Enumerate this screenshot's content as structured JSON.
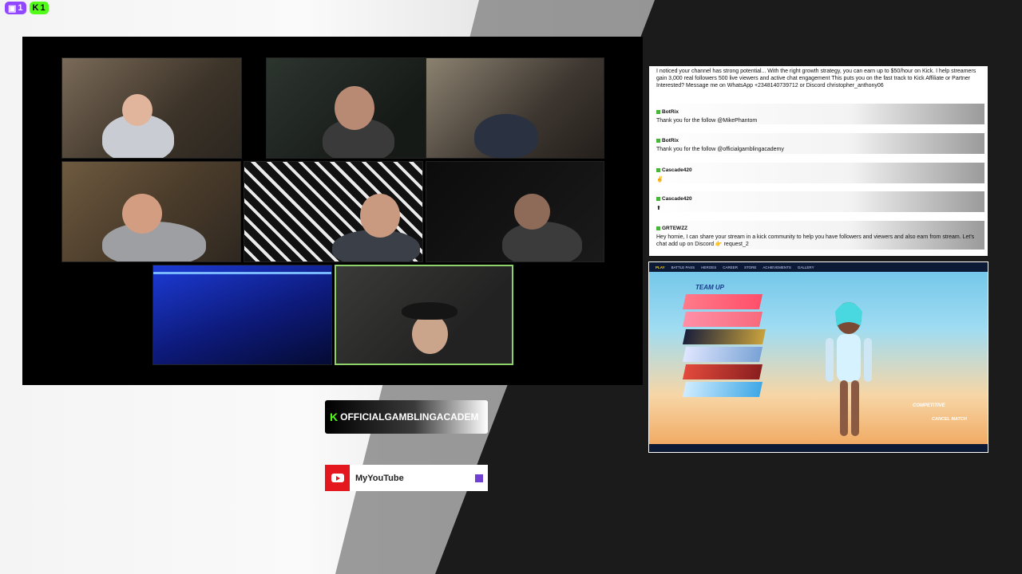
{
  "platform_badges": {
    "twitch_count": "1",
    "kick_count": "1"
  },
  "camera_grid": {
    "tiles": [
      {
        "name": "cam-1"
      },
      {
        "name": "cam-2"
      },
      {
        "name": "cam-3"
      },
      {
        "name": "cam-4"
      },
      {
        "name": "cam-5"
      },
      {
        "name": "cam-6"
      },
      {
        "name": "cam-7"
      },
      {
        "name": "cam-8"
      }
    ],
    "active_tile": "cam-8",
    "active_color": "#8fd16a"
  },
  "kick_banner": {
    "logo": "K",
    "name": "OFFICIALGAMBLINGACADEM",
    "accent": "#53fc18"
  },
  "youtube_banner": {
    "name": "MyYouTube",
    "accent": "#e4171e"
  },
  "chat": {
    "top_message": "I noticed your channel has strong potential... With the right growth strategy, you can earn up to $50/hour on Kick. I help streamers gain 3,000 real followers 500 live viewers and active chat engagement This puts you on the fast track to Kick Affiliate or Partner Interested? Message me on WhatsApp +2348140739712 or Discord christopher_anthony06",
    "messages": [
      {
        "user": "BotRix",
        "text": "Thank you for the follow @MikePhantom"
      },
      {
        "user": "BotRix",
        "text": "Thank you for the follow @officialgamblingacademy"
      },
      {
        "user": "Cascade420",
        "text": "✌"
      },
      {
        "user": "Cascade420",
        "text": "⬆"
      },
      {
        "user": "GRTEWZZ",
        "text": "Hey homie, I can share your stream in a kick community to help you have followers and viewers and also earn from stream. Let's chat add up on Discord 👉 request_2"
      }
    ]
  },
  "game": {
    "nav_items": [
      "PLAY",
      "BATTLE PASS",
      "HEROES",
      "CAREER",
      "STORE",
      "ACHIEVEMENTS",
      "GALLERY"
    ],
    "team_label": "TEAM UP",
    "mode": "COMPETITIVE",
    "cancel_label": "CANCEL MATCH"
  }
}
